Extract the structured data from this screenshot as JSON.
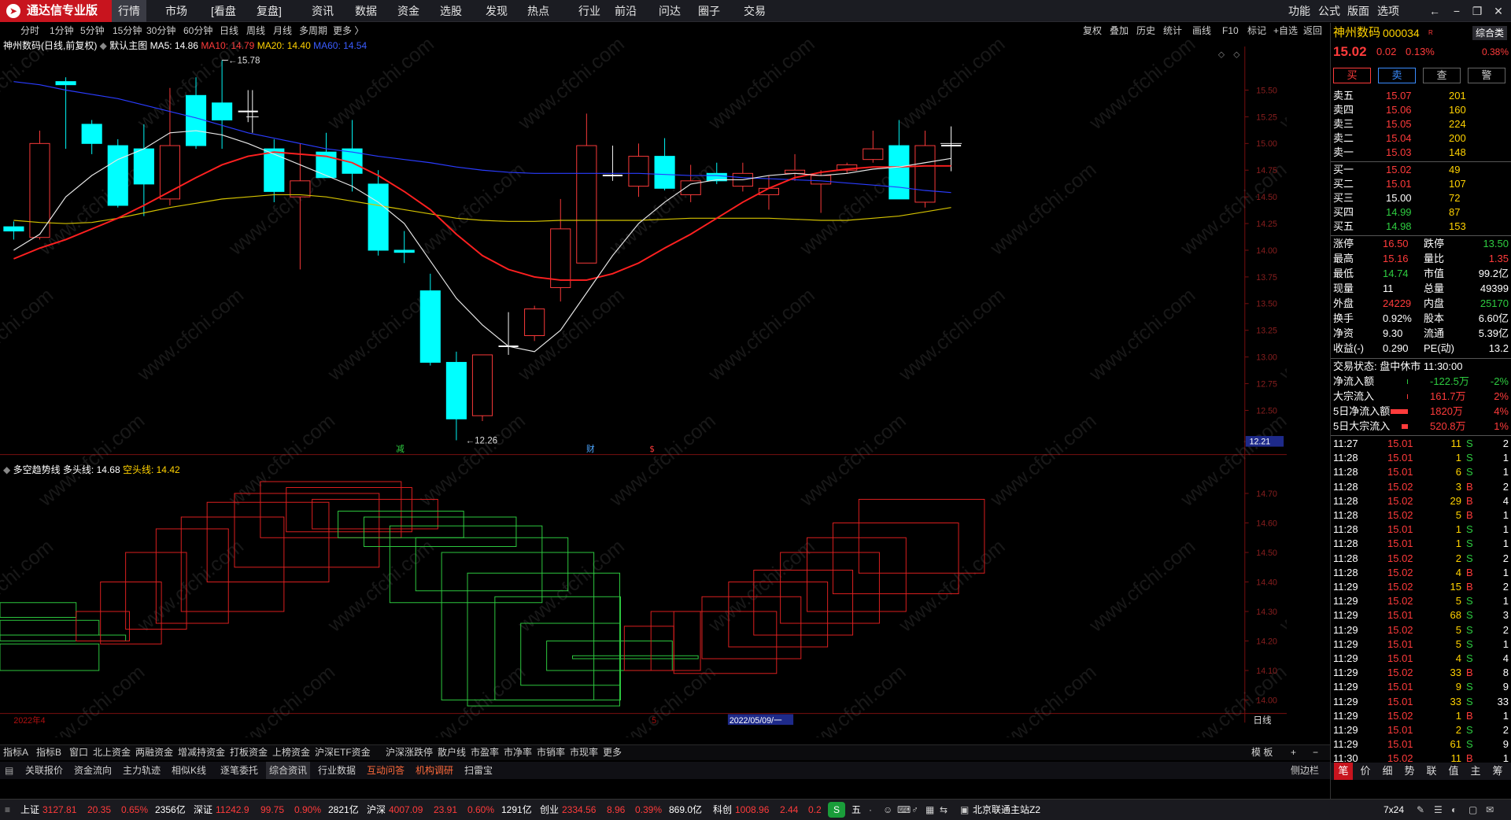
{
  "app": {
    "title": "通达信专业版",
    "menus": [
      "行情",
      "市场",
      "[看盘",
      "复盘]",
      "资讯",
      "数据",
      "资金",
      "选股",
      "发现",
      "热点",
      "行业",
      "前沿",
      "问达",
      "圈子",
      "交易"
    ],
    "right_menus": [
      "功能",
      "公式",
      "版面",
      "选项"
    ]
  },
  "periods": [
    "分时",
    "1分钟",
    "5分钟",
    "15分钟",
    "30分钟",
    "60分钟",
    "日线",
    "周线",
    "月线",
    "多周期",
    "更多 〉"
  ],
  "active_period": "日线",
  "chart_tools": [
    "复权",
    "叠加",
    "历史",
    "统计",
    "画线",
    "F10",
    "标记",
    "+自选",
    "返回"
  ],
  "main_legend": {
    "name": "神州数码(日线,前复权)",
    "theme": "默认主图",
    "ma5": "MA5: 14.86",
    "ma10": "MA10: 14.79",
    "ma20": "MA20: 14.40",
    "ma60": "MA60: 14.54"
  },
  "sub_legend": {
    "name": "多空趋势线",
    "long": "多头线: 14.68",
    "short": "空头线: 14.42"
  },
  "main_y_ticks": [
    "15.50",
    "15.25",
    "15.00",
    "14.75",
    "14.50",
    "14.25",
    "14.00",
    "13.75",
    "13.50",
    "13.25",
    "13.00",
    "12.75",
    "12.50"
  ],
  "sub_y_ticks": [
    "14.70",
    "14.60",
    "14.50",
    "14.40",
    "14.30",
    "14.20",
    "14.10",
    "14.00"
  ],
  "price_tag": "12.21",
  "high_mark": "15.78",
  "low_mark": "12.26",
  "event_marks": [
    "减",
    "财",
    "$"
  ],
  "x_labels": {
    "left": "2022年4",
    "mark": "5",
    "date": "2022/05/09/一",
    "period": "日线"
  },
  "chart_data": {
    "type": "candlestick",
    "ylim": [
      12.2,
      15.78
    ],
    "candles": [
      {
        "o": 14.22,
        "c": 14.18,
        "h": 14.27,
        "l": 14.1
      },
      {
        "o": 14.12,
        "c": 15.0,
        "h": 15.12,
        "l": 14.1
      },
      {
        "o": 15.58,
        "c": 15.55,
        "h": 15.62,
        "l": 14.95
      },
      {
        "o": 15.18,
        "c": 15.0,
        "h": 15.22,
        "l": 14.9
      },
      {
        "o": 14.98,
        "c": 14.42,
        "h": 15.04,
        "l": 14.4
      },
      {
        "o": 14.95,
        "c": 14.62,
        "h": 15.18,
        "l": 14.32
      },
      {
        "o": 14.48,
        "c": 14.98,
        "h": 15.52,
        "l": 14.42
      },
      {
        "o": 15.45,
        "c": 14.98,
        "h": 15.62,
        "l": 14.95
      },
      {
        "o": 15.38,
        "c": 15.22,
        "h": 15.78,
        "l": 14.95
      },
      {
        "o": 15.3,
        "c": 15.3,
        "h": 15.5,
        "l": 15.2
      },
      {
        "o": 14.95,
        "c": 14.55,
        "h": 15.04,
        "l": 14.45
      },
      {
        "o": 14.5,
        "c": 14.65,
        "h": 15.0,
        "l": 13.82
      },
      {
        "o": 14.92,
        "c": 14.68,
        "h": 15.1,
        "l": 14.7
      },
      {
        "o": 14.95,
        "c": 14.72,
        "h": 15.22,
        "l": 14.55
      },
      {
        "o": 14.62,
        "c": 14.0,
        "h": 14.75,
        "l": 13.95
      },
      {
        "o": 14.0,
        "c": 13.98,
        "h": 14.18,
        "l": 13.88
      },
      {
        "o": 13.62,
        "c": 12.95,
        "h": 13.78,
        "l": 12.92
      },
      {
        "o": 12.95,
        "c": 12.42,
        "h": 13.05,
        "l": 12.22
      },
      {
        "o": 12.45,
        "c": 13.02,
        "h": 13.02,
        "l": 12.4
      },
      {
        "o": 13.1,
        "c": 13.1,
        "h": 13.42,
        "l": 13.02
      },
      {
        "o": 13.2,
        "c": 13.45,
        "h": 13.48,
        "l": 13.15
      },
      {
        "o": 13.65,
        "c": 14.2,
        "h": 14.48,
        "l": 13.52
      },
      {
        "o": 13.88,
        "c": 14.98,
        "h": 15.28,
        "l": 13.88
      },
      {
        "o": 14.7,
        "c": 14.7,
        "h": 14.98,
        "l": 14.65
      },
      {
        "o": 14.6,
        "c": 14.88,
        "h": 15.0,
        "l": 14.5
      },
      {
        "o": 14.88,
        "c": 14.58,
        "h": 15.05,
        "l": 14.56
      },
      {
        "o": 14.52,
        "c": 14.65,
        "h": 14.8,
        "l": 14.45
      },
      {
        "o": 14.72,
        "c": 14.65,
        "h": 14.82,
        "l": 14.62
      },
      {
        "o": 14.6,
        "c": 14.72,
        "h": 14.82,
        "l": 14.55
      },
      {
        "o": 14.52,
        "c": 14.58,
        "h": 14.7,
        "l": 14.38
      },
      {
        "o": 14.72,
        "c": 14.75,
        "h": 14.9,
        "l": 14.65
      },
      {
        "o": 14.62,
        "c": 14.7,
        "h": 14.75,
        "l": 14.35
      },
      {
        "o": 14.75,
        "c": 14.8,
        "h": 14.82,
        "l": 14.72
      },
      {
        "o": 14.85,
        "c": 14.95,
        "h": 15.12,
        "l": 14.82
      },
      {
        "o": 14.98,
        "c": 14.48,
        "h": 15.22,
        "l": 14.48
      },
      {
        "o": 14.45,
        "c": 14.98,
        "h": 15.12,
        "l": 14.4
      },
      {
        "o": 14.98,
        "c": 14.98,
        "h": 15.16,
        "l": 14.74
      }
    ],
    "ma5": [
      14.0,
      14.15,
      14.5,
      14.7,
      14.85,
      14.95,
      15.1,
      15.12,
      15.08,
      15.0,
      14.9,
      14.8,
      14.7,
      14.6,
      14.45,
      14.25,
      13.9,
      13.55,
      13.3,
      13.1,
      13.05,
      13.25,
      13.6,
      13.95,
      14.25,
      14.45,
      14.62,
      14.66,
      14.66,
      14.7,
      14.72,
      14.7,
      14.72,
      14.76,
      14.78,
      14.82,
      14.86
    ],
    "ma10": [
      13.92,
      14.02,
      14.1,
      14.2,
      14.3,
      14.42,
      14.55,
      14.68,
      14.8,
      14.88,
      14.92,
      14.9,
      14.88,
      14.82,
      14.7,
      14.55,
      14.38,
      14.15,
      13.95,
      13.82,
      13.75,
      13.72,
      13.72,
      13.78,
      13.88,
      14.02,
      14.15,
      14.3,
      14.45,
      14.58,
      14.68,
      14.73,
      14.76,
      14.78,
      14.78,
      14.79,
      14.79
    ],
    "ma20": [
      14.28,
      14.26,
      14.25,
      14.26,
      14.3,
      14.35,
      14.4,
      14.44,
      14.48,
      14.5,
      14.52,
      14.52,
      14.5,
      14.46,
      14.42,
      14.38,
      14.34,
      14.3,
      14.28,
      14.27,
      14.27,
      14.28,
      14.28,
      14.28,
      14.28,
      14.29,
      14.3,
      14.3,
      14.3,
      14.3,
      14.29,
      14.28,
      14.28,
      14.3,
      14.32,
      14.36,
      14.4
    ],
    "ma60": [
      15.58,
      15.55,
      15.5,
      15.46,
      15.42,
      15.36,
      15.3,
      15.24,
      15.17,
      15.1,
      15.05,
      15.0,
      14.95,
      14.92,
      14.88,
      14.85,
      14.82,
      14.78,
      14.75,
      14.73,
      14.72,
      14.72,
      14.72,
      14.72,
      14.72,
      14.71,
      14.7,
      14.7,
      14.68,
      14.67,
      14.66,
      14.65,
      14.63,
      14.61,
      14.59,
      14.56,
      14.54
    ]
  },
  "sub_chart": {
    "ylim": [
      13.97,
      14.78
    ],
    "boxes": [
      {
        "x": 0,
        "w": 100,
        "t": 14.33,
        "b": 14.28,
        "c": "g"
      },
      {
        "x": 0,
        "w": 130,
        "t": 14.27,
        "b": 14.22,
        "c": "g"
      },
      {
        "x": 0,
        "w": 165,
        "t": 14.22,
        "b": 14.2,
        "c": "g"
      },
      {
        "x": 0,
        "w": 130,
        "t": 14.19,
        "b": 14.1,
        "c": "g"
      },
      {
        "x": 100,
        "w": 70,
        "t": 14.3,
        "b": 14.2,
        "c": "r"
      },
      {
        "x": 132,
        "w": 80,
        "t": 14.4,
        "b": 14.19,
        "c": "r"
      },
      {
        "x": 165,
        "w": 80,
        "t": 14.5,
        "b": 14.24,
        "c": "r"
      },
      {
        "x": 205,
        "w": 95,
        "t": 14.58,
        "b": 14.26,
        "c": "r"
      },
      {
        "x": 238,
        "w": 135,
        "t": 14.62,
        "b": 14.3,
        "c": "r"
      },
      {
        "x": 272,
        "w": 160,
        "t": 14.67,
        "b": 14.4,
        "c": "r"
      },
      {
        "x": 308,
        "w": 190,
        "t": 14.7,
        "b": 14.45,
        "c": "r"
      },
      {
        "x": 342,
        "w": 185,
        "t": 14.74,
        "b": 14.55,
        "c": "r"
      },
      {
        "x": 376,
        "w": 165,
        "t": 14.72,
        "b": 14.57,
        "c": "r"
      },
      {
        "x": 410,
        "w": 165,
        "t": 14.68,
        "b": 14.58,
        "c": "r"
      },
      {
        "x": 444,
        "w": 165,
        "t": 14.64,
        "b": 14.55,
        "c": "g"
      },
      {
        "x": 478,
        "w": 200,
        "t": 14.62,
        "b": 14.52,
        "c": "g"
      },
      {
        "x": 512,
        "w": 200,
        "t": 14.59,
        "b": 14.33,
        "c": "g"
      },
      {
        "x": 546,
        "w": 200,
        "t": 14.55,
        "b": 14.37,
        "c": "g"
      },
      {
        "x": 580,
        "w": 200,
        "t": 14.5,
        "b": 14.0,
        "c": "g"
      },
      {
        "x": 614,
        "w": 200,
        "t": 14.43,
        "b": 13.98,
        "c": "g"
      },
      {
        "x": 650,
        "w": 165,
        "t": 14.35,
        "b": 14.0,
        "c": "g"
      },
      {
        "x": 684,
        "w": 130,
        "t": 14.26,
        "b": 14.05,
        "c": "g"
      },
      {
        "x": 718,
        "w": 165,
        "t": 14.2,
        "b": 14.1,
        "c": "g"
      },
      {
        "x": 752,
        "w": 165,
        "t": 14.15,
        "b": 14.14,
        "c": "g"
      },
      {
        "x": 820,
        "w": 65,
        "t": 14.25,
        "b": 14.1,
        "c": "r"
      },
      {
        "x": 855,
        "w": 65,
        "t": 14.3,
        "b": 14.1,
        "c": "r"
      },
      {
        "x": 885,
        "w": 135,
        "t": 14.3,
        "b": 14.09,
        "c": "r"
      },
      {
        "x": 922,
        "w": 130,
        "t": 14.35,
        "b": 14.14,
        "c": "r"
      },
      {
        "x": 957,
        "w": 130,
        "t": 14.4,
        "b": 14.18,
        "c": "r"
      },
      {
        "x": 990,
        "w": 130,
        "t": 14.44,
        "b": 14.22,
        "c": "r"
      },
      {
        "x": 1025,
        "w": 130,
        "t": 14.5,
        "b": 14.26,
        "c": "r"
      },
      {
        "x": 1060,
        "w": 130,
        "t": 14.55,
        "b": 14.3,
        "c": "r"
      },
      {
        "x": 1094,
        "w": 165,
        "t": 14.6,
        "b": 14.36,
        "c": "r"
      },
      {
        "x": 1128,
        "w": 165,
        "t": 14.68,
        "b": 14.43,
        "c": "r"
      }
    ]
  },
  "quote": {
    "name": "神州数码",
    "code": "000034",
    "tag": "R",
    "sector": "综合类",
    "sector_pct": "0.38%",
    "price": "15.02",
    "change": "0.02",
    "pct": "0.13%",
    "buttons": [
      "买",
      "卖",
      "查",
      "警"
    ],
    "asks": [
      [
        "卖五",
        "15.07",
        "201"
      ],
      [
        "卖四",
        "15.06",
        "160"
      ],
      [
        "卖三",
        "15.05",
        "224"
      ],
      [
        "卖二",
        "15.04",
        "200"
      ],
      [
        "卖一",
        "15.03",
        "148"
      ]
    ],
    "bids": [
      [
        "买一",
        "15.02",
        "49"
      ],
      [
        "买二",
        "15.01",
        "107"
      ],
      [
        "买三",
        "15.00",
        "72"
      ],
      [
        "买四",
        "14.99",
        "87"
      ],
      [
        "买五",
        "14.98",
        "153"
      ]
    ],
    "stats": [
      [
        "涨停",
        "16.50",
        "跌停",
        "13.50"
      ],
      [
        "最高",
        "15.16",
        "量比",
        "1.35"
      ],
      [
        "最低",
        "14.74",
        "市值",
        "99.2亿"
      ],
      [
        "现量",
        "11",
        "总量",
        "49399"
      ],
      [
        "外盘",
        "24229",
        "内盘",
        "25170"
      ],
      [
        "换手",
        "0.92%",
        "股本",
        "6.60亿"
      ],
      [
        "净资",
        "9.30",
        "流通",
        "5.39亿"
      ],
      [
        "收益(-)",
        "0.290",
        "PE(动)",
        "13.2"
      ]
    ],
    "status": "交易状态: 盘中休市 11:30:00",
    "flows": [
      [
        "净流入额",
        "-122.5万",
        "-2%"
      ],
      [
        "大宗流入",
        "161.7万",
        "2%"
      ],
      [
        "5日净流入额",
        "1820万",
        "4%"
      ],
      [
        "5日大宗流入",
        "520.8万",
        "1%"
      ]
    ],
    "ticks": [
      [
        "11:27",
        "15.01",
        "11",
        "S",
        "2"
      ],
      [
        "11:28",
        "15.01",
        "1",
        "S",
        "1"
      ],
      [
        "11:28",
        "15.01",
        "6",
        "S",
        "1"
      ],
      [
        "11:28",
        "15.02",
        "3",
        "B",
        "2"
      ],
      [
        "11:28",
        "15.02",
        "29",
        "B",
        "4"
      ],
      [
        "11:28",
        "15.02",
        "5",
        "B",
        "1"
      ],
      [
        "11:28",
        "15.01",
        "1",
        "S",
        "1"
      ],
      [
        "11:28",
        "15.01",
        "1",
        "S",
        "1"
      ],
      [
        "11:28",
        "15.02",
        "2",
        "S",
        "2"
      ],
      [
        "11:28",
        "15.02",
        "4",
        "B",
        "1"
      ],
      [
        "11:29",
        "15.02",
        "15",
        "B",
        "2"
      ],
      [
        "11:29",
        "15.02",
        "5",
        "S",
        "1"
      ],
      [
        "11:29",
        "15.01",
        "68",
        "S",
        "3"
      ],
      [
        "11:29",
        "15.02",
        "5",
        "S",
        "2"
      ],
      [
        "11:29",
        "15.01",
        "5",
        "S",
        "1"
      ],
      [
        "11:29",
        "15.01",
        "4",
        "S",
        "4"
      ],
      [
        "11:29",
        "15.02",
        "33",
        "B",
        "8"
      ],
      [
        "11:29",
        "15.01",
        "9",
        "S",
        "9"
      ],
      [
        "11:29",
        "15.01",
        "33",
        "S",
        "33"
      ],
      [
        "11:29",
        "15.02",
        "1",
        "B",
        "1"
      ],
      [
        "11:29",
        "15.01",
        "2",
        "S",
        "2"
      ],
      [
        "11:29",
        "15.01",
        "61",
        "S",
        "9"
      ],
      [
        "11:30",
        "15.02",
        "11",
        "B",
        "1"
      ]
    ],
    "bottom_tabs": [
      "笔",
      "价",
      "细",
      "势",
      "联",
      "值",
      "主",
      "筹"
    ]
  },
  "tabbar1": [
    "指标A",
    "指标B",
    "窗口",
    "北上资金",
    "两融资金",
    "增减持资金",
    "打板资金",
    "上榜资金",
    "沪深ETF资金",
    "沪深涨跌停",
    "散户线",
    "市盈率",
    "市净率",
    "市销率",
    "市现率",
    "更多"
  ],
  "tabbar1_right": [
    "模 板",
    "+",
    "−"
  ],
  "tabbar2": [
    "关联报价",
    "资金流向",
    "主力轨迹",
    "相似K线",
    "逐笔委托",
    "综合资讯",
    "行业数据",
    "互动问答",
    "机构调研",
    "扫雷宝"
  ],
  "tabbar2_right": "侧边栏",
  "statusbar": {
    "items": [
      [
        "上证",
        "3127.81",
        "20.35",
        "0.65%",
        "2356亿"
      ],
      [
        "深证",
        "11242.9",
        "99.75",
        "0.90%",
        "2821亿"
      ],
      [
        "沪深",
        "4007.09",
        "23.91",
        "0.60%",
        "1291亿"
      ],
      [
        "创业",
        "2334.56",
        "8.96",
        "0.39%",
        "869.0亿"
      ],
      [
        "科创",
        "1008.96",
        "2.44",
        "0.2"
      ]
    ],
    "server": "北京联通主站Z2",
    "clock": "7x24",
    "ime": "五"
  },
  "watermark": "www.cfchi.com"
}
